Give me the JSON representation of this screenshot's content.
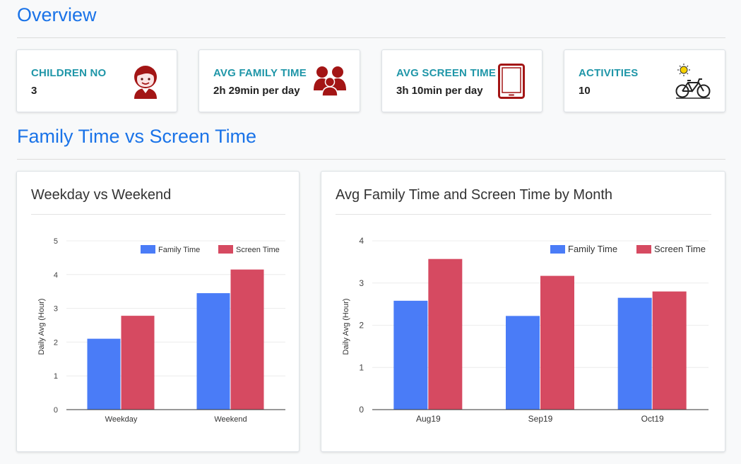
{
  "overview": {
    "title": "Overview",
    "stats": [
      {
        "label": "CHILDREN NO",
        "value": "3",
        "icon": "child-icon"
      },
      {
        "label": "AVG FAMILY TIME",
        "value": "2h 29min per day",
        "icon": "family-icon"
      },
      {
        "label": "AVG SCREEN TIME",
        "value": "3h 10min per day",
        "icon": "tablet-icon"
      },
      {
        "label": "ACTIVITIES",
        "value": "10",
        "icon": "bicycle-sun-icon"
      }
    ]
  },
  "comparison": {
    "title": "Family Time vs Screen Time"
  },
  "colors": {
    "accent": "#1a73e8",
    "stat_label": "#1f96a8",
    "family": "#4a7cf7",
    "screen": "#d64a61",
    "icon_red": "#a31515"
  },
  "chart_data": [
    {
      "type": "bar",
      "title": "Weekday vs Weekend",
      "categories": [
        "Weekday",
        "Weekend"
      ],
      "series": [
        {
          "name": "Family Time",
          "values": [
            2.1,
            3.45
          ]
        },
        {
          "name": "Screen Time",
          "values": [
            2.78,
            4.15
          ]
        }
      ],
      "xlabel": "",
      "ylabel": "Daily Avg (Hour)",
      "ylim": [
        0,
        5
      ],
      "yticks": [
        "0",
        "1",
        "2",
        "3",
        "4",
        "5"
      ],
      "grid": true,
      "legend": "top-right"
    },
    {
      "type": "bar",
      "title": "Avg Family Time and Screen Time by Month",
      "categories": [
        "Aug19",
        "Sep19",
        "Oct19"
      ],
      "series": [
        {
          "name": "Family Time",
          "values": [
            2.58,
            2.22,
            2.65
          ]
        },
        {
          "name": "Screen Time",
          "values": [
            3.57,
            3.17,
            2.8
          ]
        }
      ],
      "xlabel": "",
      "ylabel": "Daily Avg (Hour)",
      "ylim": [
        0,
        4
      ],
      "yticks": [
        "0",
        "1",
        "2",
        "3",
        "4"
      ],
      "grid": true,
      "legend": "top-right"
    }
  ]
}
